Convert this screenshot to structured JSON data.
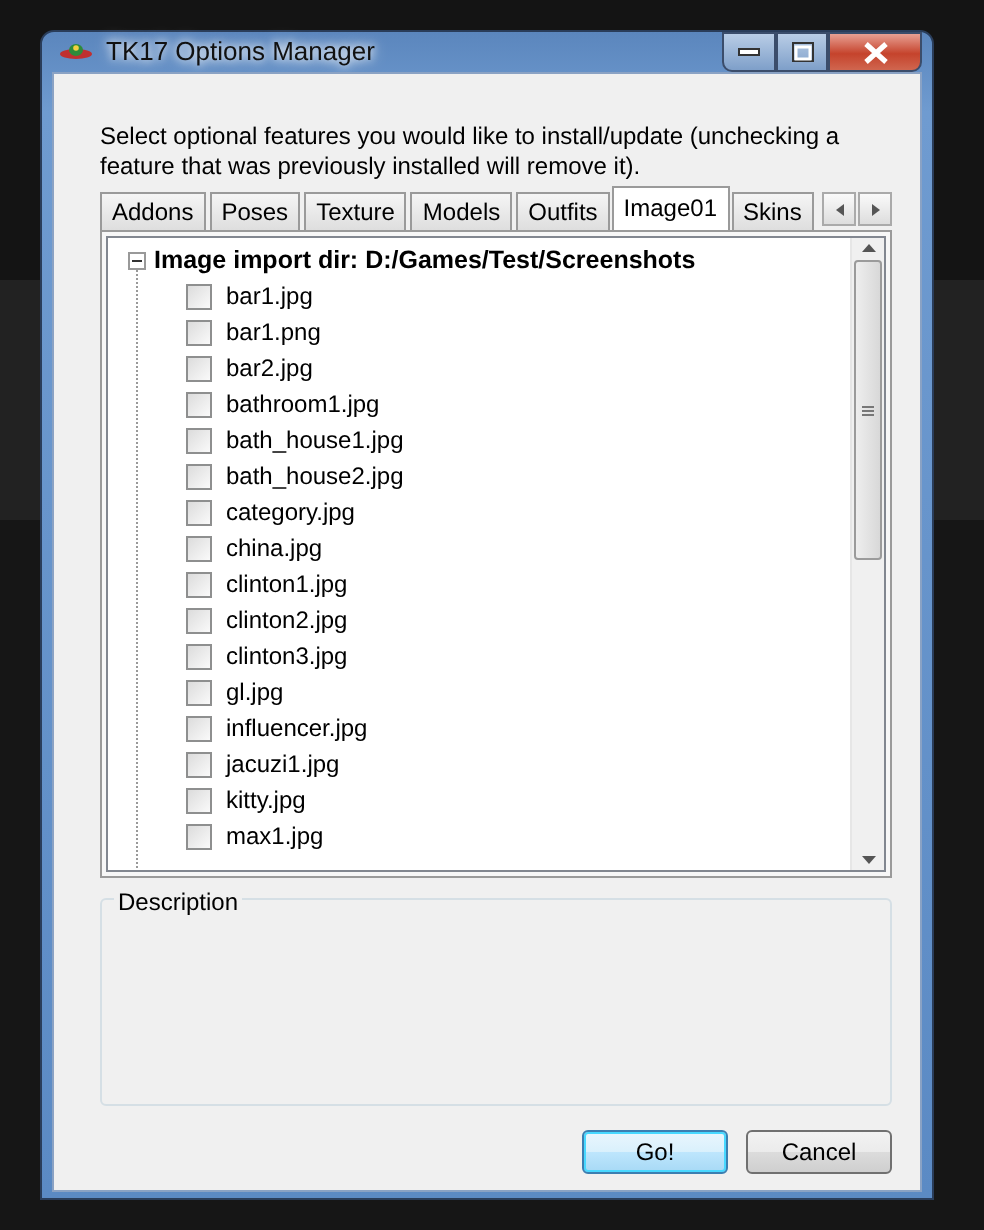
{
  "window": {
    "title": "TK17 Options Manager"
  },
  "instructions": "Select optional features you would like to install/update (unchecking a feature that was previously installed will remove it).",
  "tabs": [
    {
      "label": "Addons",
      "selected": false
    },
    {
      "label": "Poses",
      "selected": false
    },
    {
      "label": "Texture",
      "selected": false
    },
    {
      "label": "Models",
      "selected": false
    },
    {
      "label": "Outfits",
      "selected": false
    },
    {
      "label": "Image01",
      "selected": true
    },
    {
      "label": "Skins",
      "selected": false
    }
  ],
  "tree": {
    "label": "Image import dir: D:/Games/Test/Screenshots",
    "expanded": true,
    "children": [
      {
        "label": "bar1.jpg",
        "checked": false
      },
      {
        "label": "bar1.png",
        "checked": false
      },
      {
        "label": "bar2.jpg",
        "checked": false
      },
      {
        "label": "bathroom1.jpg",
        "checked": false
      },
      {
        "label": "bath_house1.jpg",
        "checked": false
      },
      {
        "label": "bath_house2.jpg",
        "checked": false
      },
      {
        "label": "category.jpg",
        "checked": false
      },
      {
        "label": "china.jpg",
        "checked": false
      },
      {
        "label": "clinton1.jpg",
        "checked": false
      },
      {
        "label": "clinton2.jpg",
        "checked": false
      },
      {
        "label": "clinton3.jpg",
        "checked": false
      },
      {
        "label": "gl.jpg",
        "checked": false
      },
      {
        "label": "influencer.jpg",
        "checked": false
      },
      {
        "label": "jacuzi1.jpg",
        "checked": false
      },
      {
        "label": "kitty.jpg",
        "checked": false
      },
      {
        "label": "max1.jpg",
        "checked": false
      }
    ]
  },
  "description": {
    "label": "Description"
  },
  "buttons": [
    {
      "label": "Go!",
      "default": true
    },
    {
      "label": "Cancel",
      "default": false
    }
  ]
}
